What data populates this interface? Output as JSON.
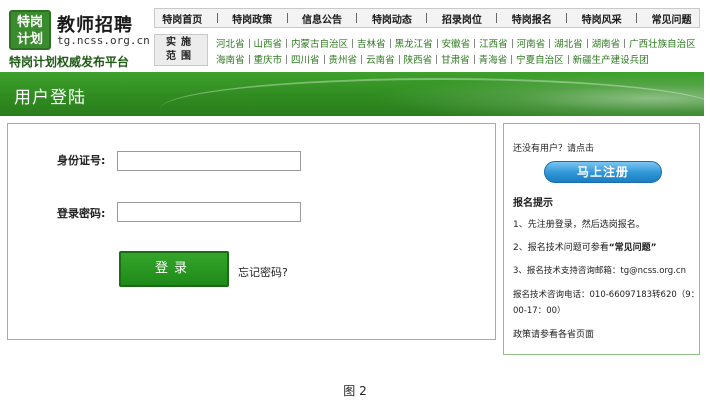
{
  "logo": {
    "badge_line1": "特岗",
    "badge_line2": "计划",
    "title": "教师招聘",
    "url": "tg.ncss.org.cn",
    "slogan": "特岗计划权威发布平台"
  },
  "topnav": [
    "特岗首页",
    "特岗政策",
    "信息公告",
    "特岗动态",
    "招录岗位",
    "特岗报名",
    "特岗风采",
    "常见问题"
  ],
  "area": {
    "label1": "实施",
    "label2": "范围"
  },
  "provinces_row1": [
    "河北省",
    "山西省",
    "内蒙古自治区",
    "吉林省",
    "黑龙江省",
    "安徽省",
    "江西省",
    "河南省",
    "湖北省",
    "湖南省",
    "广西壮族自治区"
  ],
  "provinces_row2": [
    "海南省",
    "重庆市",
    "四川省",
    "贵州省",
    "云南省",
    "陕西省",
    "甘肃省",
    "青海省",
    "宁夏自治区",
    "新疆生产建设兵团"
  ],
  "banner": {
    "title": "用户登陆"
  },
  "login": {
    "id_label": "身份证号:",
    "id_value": "",
    "pwd_label": "登录密码:",
    "pwd_value": "",
    "submit": "登录",
    "forgot": "忘记密码?"
  },
  "side": {
    "no_account": "还没有用户？请点击",
    "register": "马上注册",
    "hint_title": "报名提示",
    "hint1": "1、先注册登录，然后选岗报名。",
    "hint2_prefix": "2、报名技术问题可参看",
    "hint2_link": "“常见问题”",
    "hint3": "3、报名技术支持咨询邮箱：tg@ncss.org.cn",
    "phone_line1": "报名技术咨询电话：010-66097183转620（9：",
    "phone_line2": "00-17：00）",
    "policy": "政策请参看各省页面"
  },
  "caption": "图 2"
}
